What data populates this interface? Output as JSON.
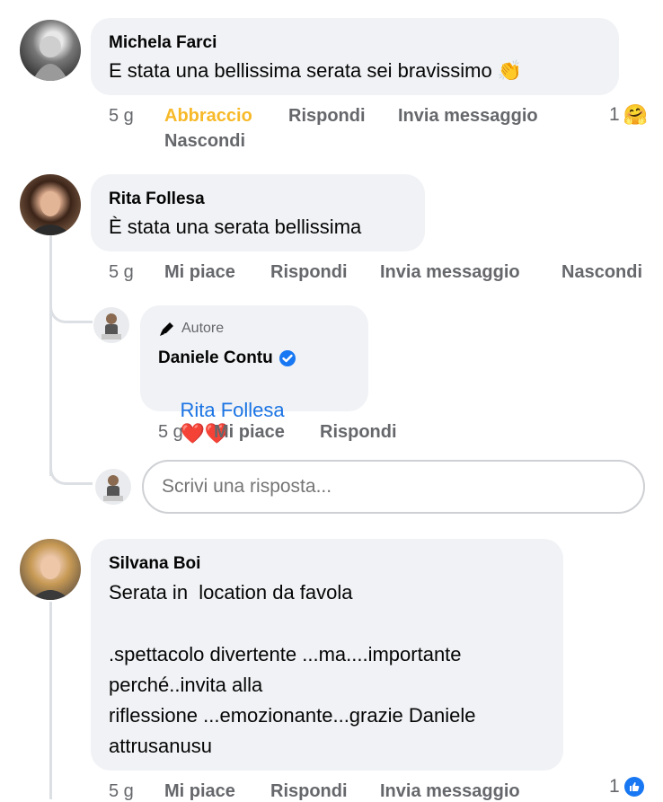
{
  "comments": [
    {
      "author": "Michela Farci",
      "text": "E stata una bellissima serata sei bravissimo 👏",
      "time": "5 g",
      "reaction_label": "Abbraccio",
      "reply_label": "Rispondi",
      "message_label": "Invia messaggio",
      "hide_label": "Nascondi",
      "reaction_count": "1",
      "reaction_emoji": "🤗"
    },
    {
      "author": "Rita Follesa",
      "text": "È stata una serata bellissima",
      "time": "5 g",
      "like_label": "Mi piace",
      "reply_label": "Rispondi",
      "message_label": "Invia messaggio",
      "hide_label": "Nascondi",
      "reply": {
        "badge": "Autore",
        "author": "Daniele Contu",
        "mention": "Rita Follesa",
        "hearts": "❤️❤️",
        "time": "5 g",
        "like_label": "Mi piace",
        "reply_label": "Rispondi"
      },
      "reply_input_placeholder": "Scrivi una risposta..."
    },
    {
      "author": "Silvana Boi",
      "text_lines": [
        "Serata in  location da favola",
        "",
        ".spettacolo divertente ...ma....importante",
        "perché..invita alla",
        "riflessione ...emozionante...grazie Daniele",
        "attrusanusu"
      ],
      "time": "5 g",
      "like_label": "Mi piace",
      "reply_label": "Rispondi",
      "message_label": "Invia messaggio",
      "reaction_count": "1"
    }
  ],
  "colors": {
    "reaction_hug": "#f7b928",
    "link_blue": "#1b74e4",
    "verified": "#1877f2",
    "secondary_text": "#65676b",
    "bubble_bg": "#f0f2f5"
  }
}
